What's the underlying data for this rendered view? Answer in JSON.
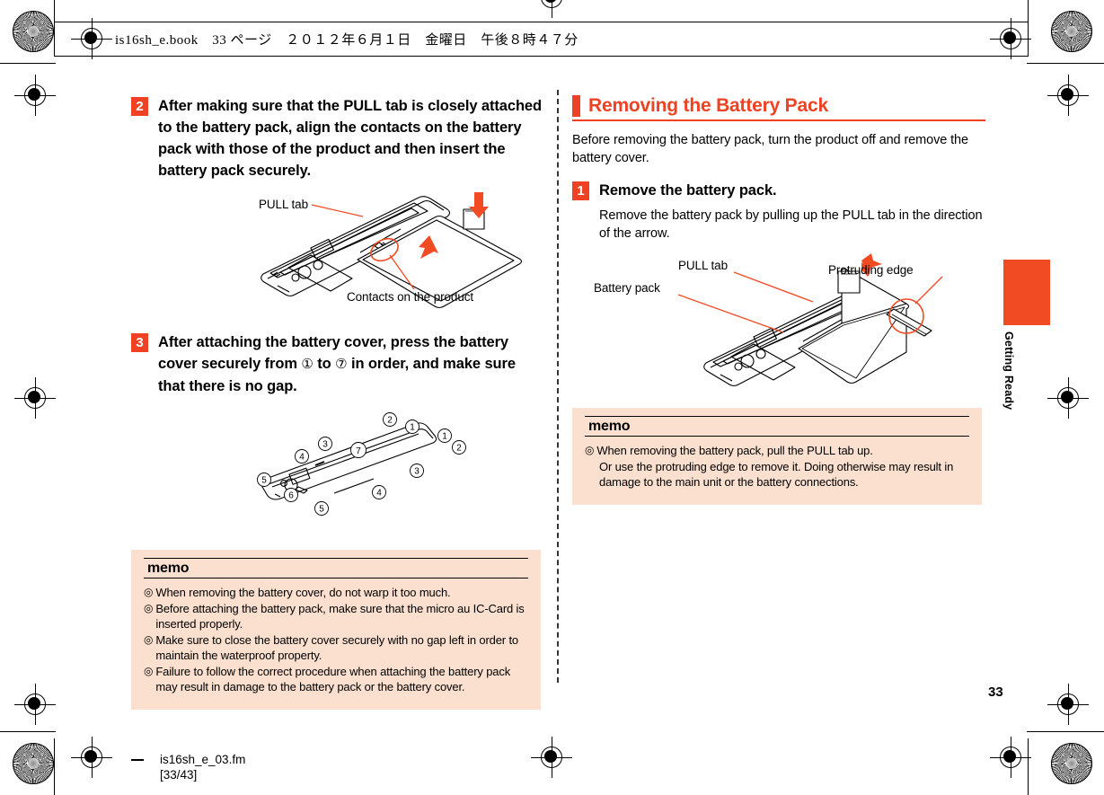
{
  "document": {
    "header_line": "is16sh_e.book　33 ページ　２０１２年６月１日　金曜日　午後８時４７分",
    "page_number": "33",
    "footer_file": "is16sh_e_03.fm",
    "footer_pages": "[33/43]",
    "thumb_tab_label": "Getting Ready"
  },
  "colors": {
    "accent": "#ef4123",
    "tab": "#f04b23",
    "memo_bg": "#fbe0cf"
  },
  "left_column": {
    "step2": {
      "number": "2",
      "text": "After making sure that the PULL tab is closely attached to the battery pack, align the contacts on the battery pack with those of the product and then insert the battery pack securely."
    },
    "figure1": {
      "label_pull_tab": "PULL tab",
      "label_contacts": "Contacts on the product"
    },
    "step3": {
      "number": "3",
      "text_part1": "After attaching the battery cover, press the battery cover securely from ",
      "circled_first": "①",
      "text_part2": " to ",
      "circled_last": "⑦",
      "text_part3": " in order, and make sure that there is no gap."
    },
    "figure2": {
      "callouts": [
        "①",
        "②",
        "③",
        "④",
        "⑤",
        "⑥",
        "⑦"
      ]
    },
    "memo": {
      "title": "memo",
      "bullet": "◎",
      "items": [
        "When removing the battery cover, do not warp it too much.",
        "Before attaching the battery pack, make sure that the micro au IC-Card is inserted properly.",
        "Make sure to close the battery cover securely with no gap left in order to maintain the waterproof property.",
        "Failure to follow the correct procedure when attaching the battery pack may result in damage to the battery pack or the battery cover."
      ]
    }
  },
  "right_column": {
    "section_title": "Removing the Battery Pack",
    "intro": "Before removing the battery pack, turn the product off and remove the battery cover.",
    "step1": {
      "number": "1",
      "heading": "Remove the battery pack.",
      "detail": "Remove the battery pack by pulling up the PULL tab in the direction of the arrow."
    },
    "figure3": {
      "label_pull_tab": "PULL tab",
      "label_protruding_edge": "Protruding edge",
      "label_battery_pack": "Battery pack"
    },
    "memo": {
      "title": "memo",
      "bullet": "◎",
      "items": [
        "When removing the battery pack, pull the PULL tab up.",
        "Or use the protruding edge to remove it. Doing otherwise may result in damage to the main unit or the battery connections."
      ]
    }
  }
}
